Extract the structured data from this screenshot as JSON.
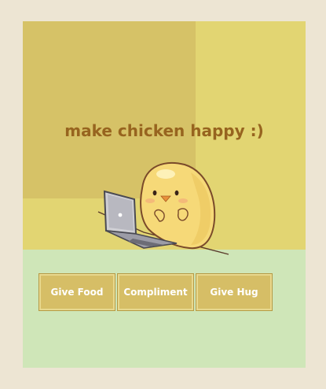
{
  "game": {
    "title": "make chicken happy :)",
    "character_icon": "chick-with-laptop",
    "colors": {
      "page_bg": "#ede5d3",
      "wall": "#e2d572",
      "wall_shade": "#d6c267",
      "floor": "#cfe6b8",
      "title": "#97641f",
      "button_bg": "#d6be66",
      "button_text": "#ffffff"
    },
    "actions": [
      {
        "label": "Give Food"
      },
      {
        "label": "Compliment"
      },
      {
        "label": "Give Hug"
      }
    ]
  }
}
